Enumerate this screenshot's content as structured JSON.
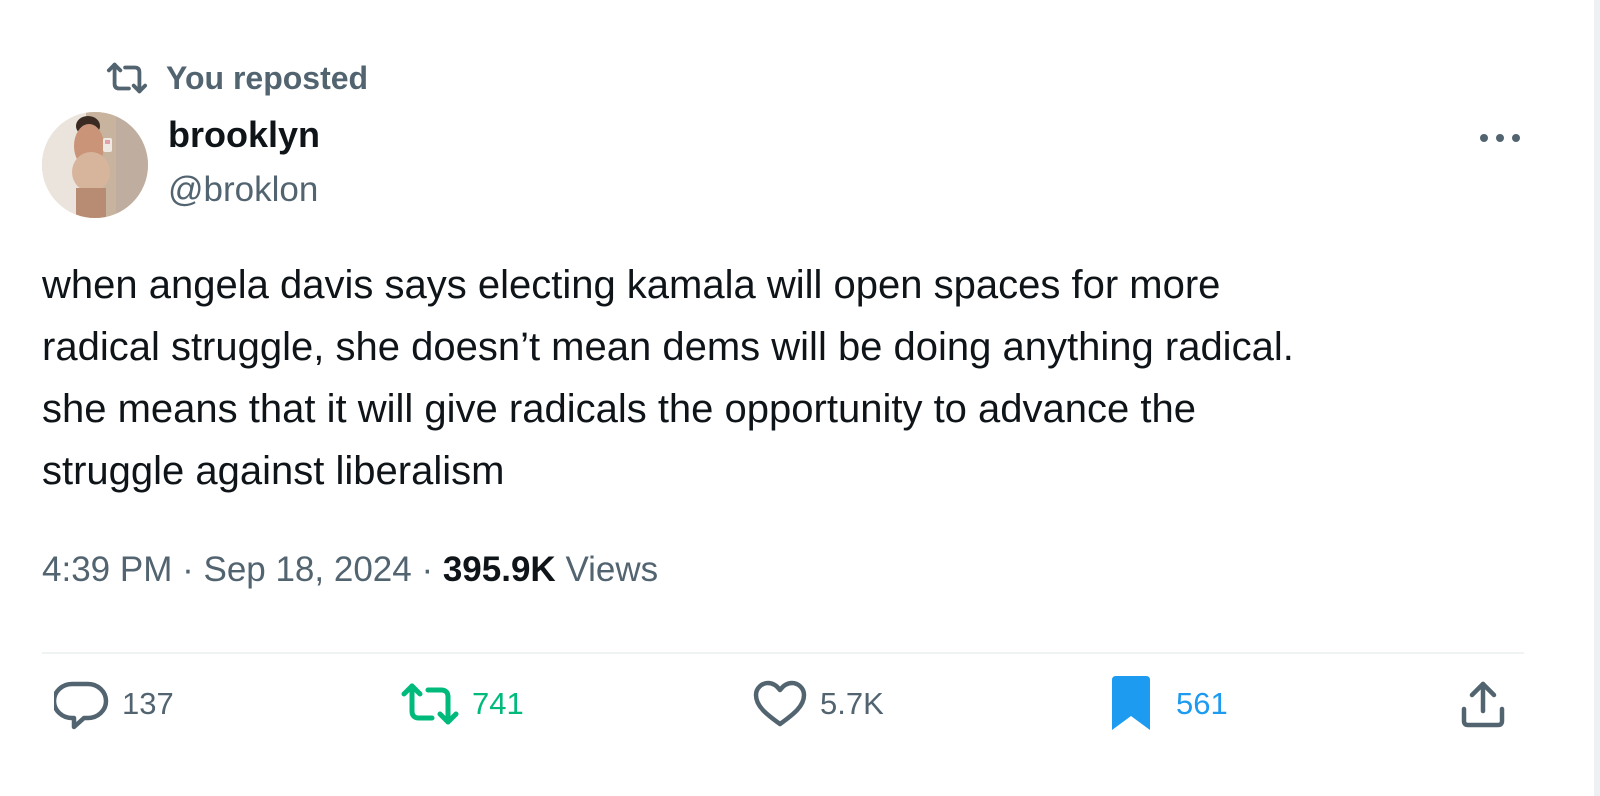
{
  "repost_banner": {
    "text": "You reposted",
    "icon": "repost-icon"
  },
  "author": {
    "display_name": "brooklyn",
    "handle": "@broklon",
    "avatar": "profile-photo"
  },
  "more_icon": "ellipsis-icon",
  "tweet": {
    "text": "when angela davis says electing kamala will open spaces for more\nradical struggle, she doesn’t mean dems will be doing anything radical.\nshe means that it will give radicals the opportunity to advance the\nstruggle against liberalism"
  },
  "meta": {
    "time": "4:39 PM",
    "separator": " · ",
    "date": "Sep 18, 2024",
    "views_count": "395.9K",
    "views_label": "Views"
  },
  "actions": {
    "reply": {
      "icon": "speech-bubble-icon",
      "count": "137"
    },
    "retweet": {
      "icon": "repost-icon",
      "count": "741",
      "active": true
    },
    "like": {
      "icon": "heart-icon",
      "count": "5.7K"
    },
    "bookmark": {
      "icon": "bookmark-icon",
      "count": "561",
      "active": true
    },
    "share": {
      "icon": "upload-icon"
    }
  },
  "colors": {
    "text_primary": "#0f1419",
    "text_secondary": "#536471",
    "retweet_active": "#00ba7c",
    "bookmark_active": "#1d9bf0",
    "divider": "#eff3f4"
  }
}
